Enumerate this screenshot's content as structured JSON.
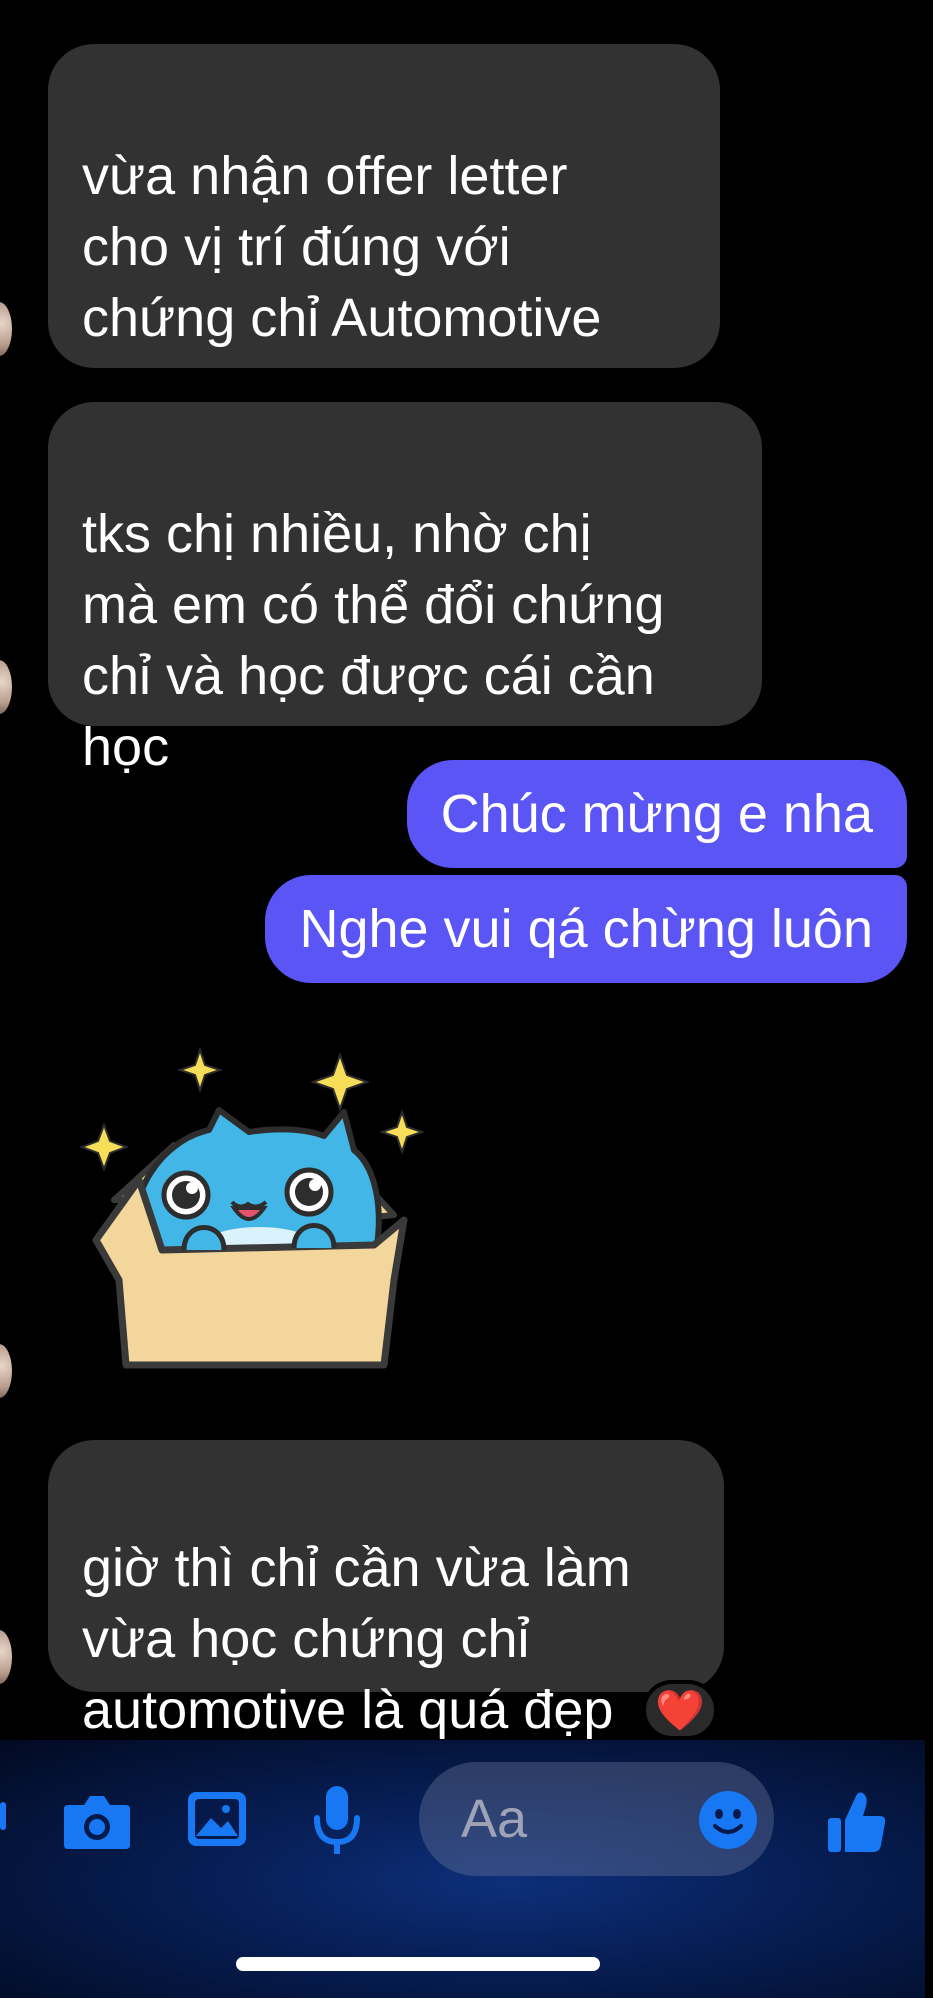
{
  "messages": [
    {
      "id": "m1",
      "from": "contact",
      "text": "vừa nhận offer letter\ncho vị trí đúng với\nchứng chỉ Automotive"
    },
    {
      "id": "m2",
      "from": "contact",
      "text": "tks chị nhiều, nhờ chị\nmà em có thể đổi chứng\nchỉ và học được cái cần\nhọc"
    },
    {
      "id": "m3",
      "from": "me",
      "text": "Chúc mừng e nha"
    },
    {
      "id": "m4",
      "from": "me",
      "text": "Nghe vui qá chừng luôn"
    },
    {
      "id": "m5",
      "from": "contact",
      "type": "sticker",
      "icon": "cat-in-box-sticker"
    },
    {
      "id": "m6",
      "from": "contact",
      "text": "giờ thì chỉ cần vừa làm\nvừa học chứng chỉ\nautomotive là quá đẹp",
      "reaction": "❤️"
    }
  ],
  "emoji": {
    "m1": "😀"
  },
  "composer": {
    "placeholder": "Aa",
    "icons": [
      "camera-icon",
      "photo-icon",
      "microphone-icon",
      "emoji-icon",
      "thumbs-up-icon"
    ]
  },
  "colors": {
    "background": "#000000",
    "incoming_bubble": "#323232",
    "outgoing_bubble": "#5b55f5",
    "accent": "#1877f2"
  }
}
